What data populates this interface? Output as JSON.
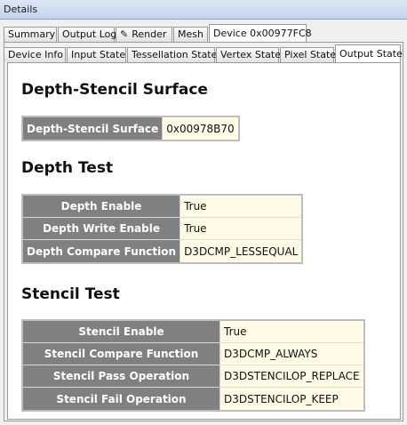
{
  "window": {
    "title": "Details"
  },
  "tabs_top": [
    {
      "label": "Summary",
      "active": false
    },
    {
      "label": "Output Log",
      "active": false
    },
    {
      "label": "Render",
      "active": false,
      "icon": "edit-icon"
    },
    {
      "label": "Mesh",
      "active": false
    },
    {
      "label": "Device 0x00977FC8",
      "active": true
    }
  ],
  "tabs_sub": [
    {
      "label": "Device Info",
      "active": false
    },
    {
      "label": "Input State",
      "active": false
    },
    {
      "label": "Tessellation State",
      "active": false
    },
    {
      "label": "Vertex State",
      "active": false
    },
    {
      "label": "Pixel State",
      "active": false
    },
    {
      "label": "Output State",
      "active": true
    }
  ],
  "sections": {
    "depth_stencil": {
      "heading": "Depth-Stencil Surface",
      "rows": [
        {
          "key": "Depth-Stencil Surface",
          "value": "0x00978B70"
        }
      ]
    },
    "depth_test": {
      "heading": "Depth Test",
      "rows": [
        {
          "key": "Depth Enable",
          "value": "True"
        },
        {
          "key": "Depth Write Enable",
          "value": "True"
        },
        {
          "key": "Depth Compare Function",
          "value": "D3DCMP_LESSEQUAL"
        }
      ]
    },
    "stencil_test": {
      "heading": "Stencil Test",
      "rows": [
        {
          "key": "Stencil Enable",
          "value": "True"
        },
        {
          "key": "Stencil Compare Function",
          "value": "D3DCMP_ALWAYS"
        },
        {
          "key": "Stencil Pass Operation",
          "value": "D3DSTENCILOP_REPLACE"
        },
        {
          "key": "Stencil Fail Operation",
          "value": "D3DSTENCILOP_KEEP"
        }
      ]
    }
  }
}
